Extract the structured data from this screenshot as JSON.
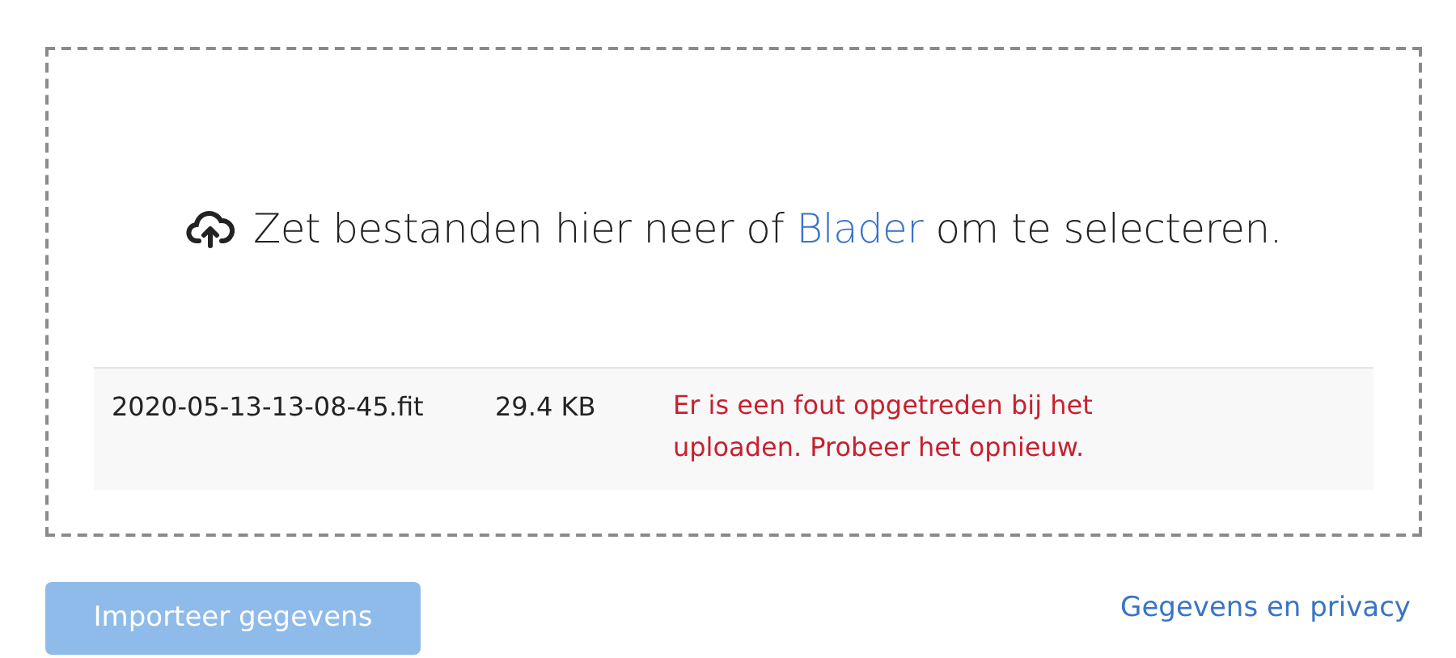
{
  "dropzone": {
    "prompt_before": "Zet bestanden hier neer of ",
    "browse_link": "Blader",
    "prompt_after": " om te selecteren."
  },
  "files": [
    {
      "name": "2020-05-13-13-08-45.fit",
      "size": "29.4 KB",
      "failed": true,
      "message": "Er is een fout opgetreden bij het uploaden. Probeer het opnieuw."
    }
  ],
  "import_button": {
    "label": "Importeer gegevens",
    "disabled": true
  },
  "privacy_link": "Gegevens en privacy"
}
